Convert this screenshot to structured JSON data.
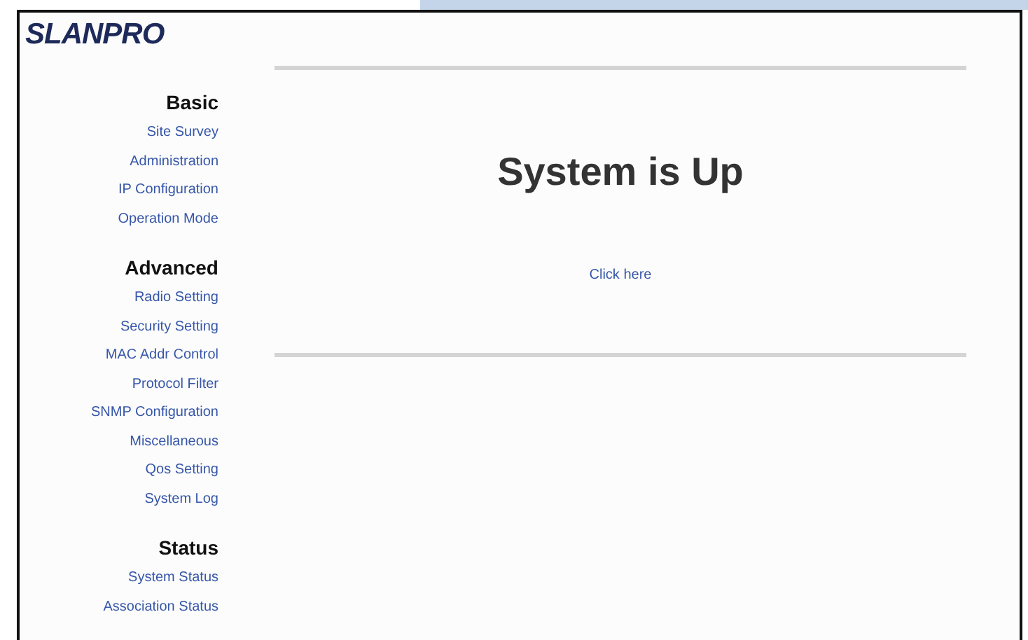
{
  "logo": {
    "text": "SLANPRO"
  },
  "sidebar": {
    "sections": [
      {
        "heading": "Basic",
        "items": [
          "Site Survey",
          "Administration",
          "IP Configuration",
          "Operation Mode"
        ]
      },
      {
        "heading": "Advanced",
        "items": [
          "Radio Setting",
          "Security Setting",
          "MAC Addr Control",
          "Protocol Filter",
          "SNMP Configuration",
          "Miscellaneous",
          "Qos Setting",
          "System Log"
        ]
      },
      {
        "heading": "Status",
        "items": [
          "System Status",
          "Association Status"
        ]
      }
    ]
  },
  "main": {
    "title": "System is Up",
    "link": "Click here"
  }
}
